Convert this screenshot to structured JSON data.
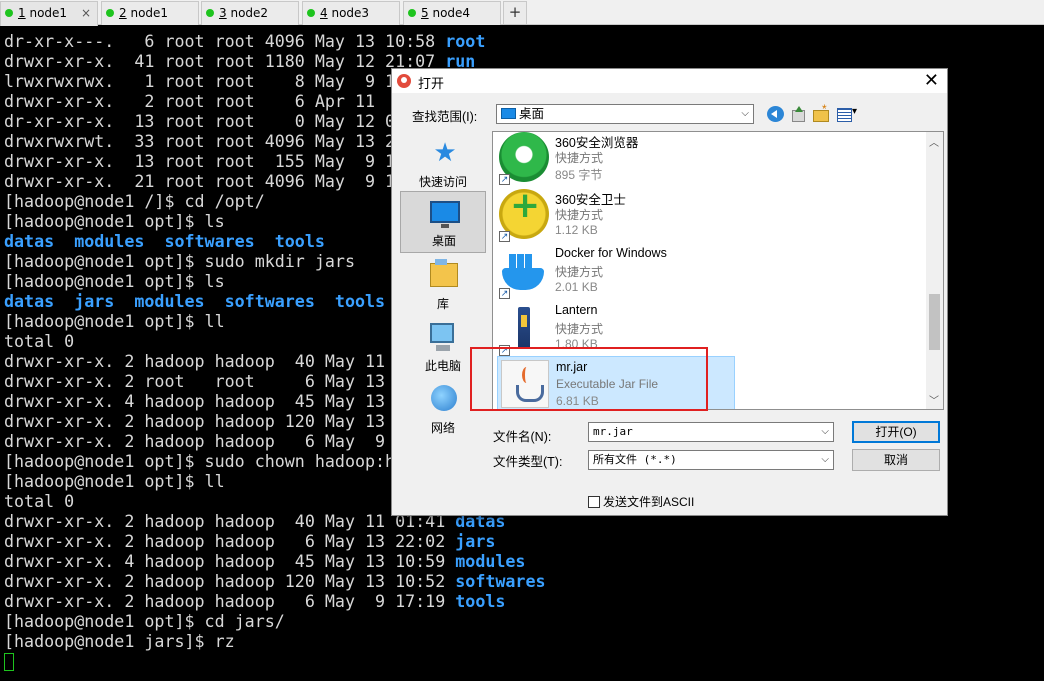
{
  "tabs": [
    {
      "num": "1",
      "name": "node1",
      "active": true
    },
    {
      "num": "2",
      "name": "node1"
    },
    {
      "num": "3",
      "name": "node2"
    },
    {
      "num": "4",
      "name": "node3"
    },
    {
      "num": "5",
      "name": "node4"
    }
  ],
  "tab_close_glyph": "×",
  "tab_add_glyph": "+",
  "terminal": {
    "lines": [
      [
        "dr-xr-x---.   6 root root 4096 May 13 10:58 ",
        {
          "hl": "root"
        }
      ],
      [
        "drwxr-xr-x.  41 root root 1180 May 12 21:07 ",
        {
          "hl": "run"
        }
      ],
      [
        "lrwxrwxrwx.   1 root root    8 May  9 1"
      ],
      [
        "drwxr-xr-x.   2 root root    6 Apr 11"
      ],
      [
        "dr-xr-xr-x.  13 root root    0 May 12 0"
      ],
      [
        "drwxrwxrwt.  33 root root 4096 May 13 2"
      ],
      [
        "drwxr-xr-x.  13 root root  155 May  9 1"
      ],
      [
        "drwxr-xr-x.  21 root root 4096 May  9 1"
      ],
      [
        "[hadoop@node1 /]$ cd /opt/"
      ],
      [
        "[hadoop@node1 opt]$ ls"
      ],
      [
        {
          "hl": "datas  modules  softwares  tools"
        }
      ],
      [
        "[hadoop@node1 opt]$ sudo mkdir jars"
      ],
      [
        "[hadoop@node1 opt]$ ls"
      ],
      [
        {
          "hl": "datas  jars  modules  softwares  tools"
        }
      ],
      [
        "[hadoop@node1 opt]$ ll"
      ],
      [
        "total 0"
      ],
      [
        "drwxr-xr-x. 2 hadoop hadoop  40 May 11"
      ],
      [
        "drwxr-xr-x. 2 root   root     6 May 13"
      ],
      [
        "drwxr-xr-x. 4 hadoop hadoop  45 May 13"
      ],
      [
        "drwxr-xr-x. 2 hadoop hadoop 120 May 13"
      ],
      [
        "drwxr-xr-x. 2 hadoop hadoop   6 May  9"
      ],
      [
        "[hadoop@node1 opt]$ sudo chown hadoop:h"
      ],
      [
        "[hadoop@node1 opt]$ ll"
      ],
      [
        "total 0"
      ],
      [
        "drwxr-xr-x. 2 hadoop hadoop  40 May 11 01:41 ",
        {
          "hl": "datas"
        }
      ],
      [
        "drwxr-xr-x. 2 hadoop hadoop   6 May 13 22:02 ",
        {
          "hl": "jars"
        }
      ],
      [
        "drwxr-xr-x. 4 hadoop hadoop  45 May 13 10:59 ",
        {
          "hl": "modules"
        }
      ],
      [
        "drwxr-xr-x. 2 hadoop hadoop 120 May 13 10:52 ",
        {
          "hl": "softwares"
        }
      ],
      [
        "drwxr-xr-x. 2 hadoop hadoop   6 May  9 17:19 ",
        {
          "hl": "tools"
        }
      ],
      [
        "[hadoop@node1 opt]$ cd jars/"
      ],
      [
        "[hadoop@node1 jars]$ rz"
      ]
    ],
    "prompt_color": "#d8d8d8",
    "dir_color": "#3aa0ff",
    "cursor_color": "#1ec41e"
  },
  "dialog": {
    "title": "打开",
    "close_glyph": "✕",
    "lookin_label": "查找范围(I):",
    "lookin_value": "桌面",
    "dropdown_glyph": "⌵",
    "places": [
      {
        "label": "快速访问",
        "icon": "star-icon"
      },
      {
        "label": "桌面",
        "icon": "desktop-icon",
        "selected": true
      },
      {
        "label": "库",
        "icon": "library-icon"
      },
      {
        "label": "此电脑",
        "icon": "computer-icon"
      },
      {
        "label": "网络",
        "icon": "network-icon"
      }
    ],
    "files": [
      {
        "name": "360安全浏览器",
        "type": "快捷方式",
        "size": "895 字节",
        "icon": "360-browser-icon"
      },
      {
        "name": "360安全卫士",
        "type": "快捷方式",
        "size": "1.12 KB",
        "icon": "360-safe-icon"
      },
      {
        "name": "Docker for Windows",
        "type": "快捷方式",
        "size": "2.01 KB",
        "icon": "docker-icon"
      },
      {
        "name": "Lantern",
        "type": "快捷方式",
        "size": "1.80 KB",
        "icon": "lantern-icon"
      },
      {
        "name": "mr.jar",
        "type": "Executable Jar File",
        "size": "6.81 KB",
        "icon": "java-jar-icon",
        "selected": true
      }
    ],
    "shortcut_glyph": "↗",
    "filename_label": "文件名(N):",
    "filename_value": "mr.jar",
    "filetype_label": "文件类型(T):",
    "filetype_value": "所有文件 (*.*)",
    "open_button": "打开(O)",
    "cancel_button": "取消",
    "ascii_checkbox": "发送文件到ASCII",
    "ascii_checked": false,
    "highlight_color": "#e02020"
  }
}
